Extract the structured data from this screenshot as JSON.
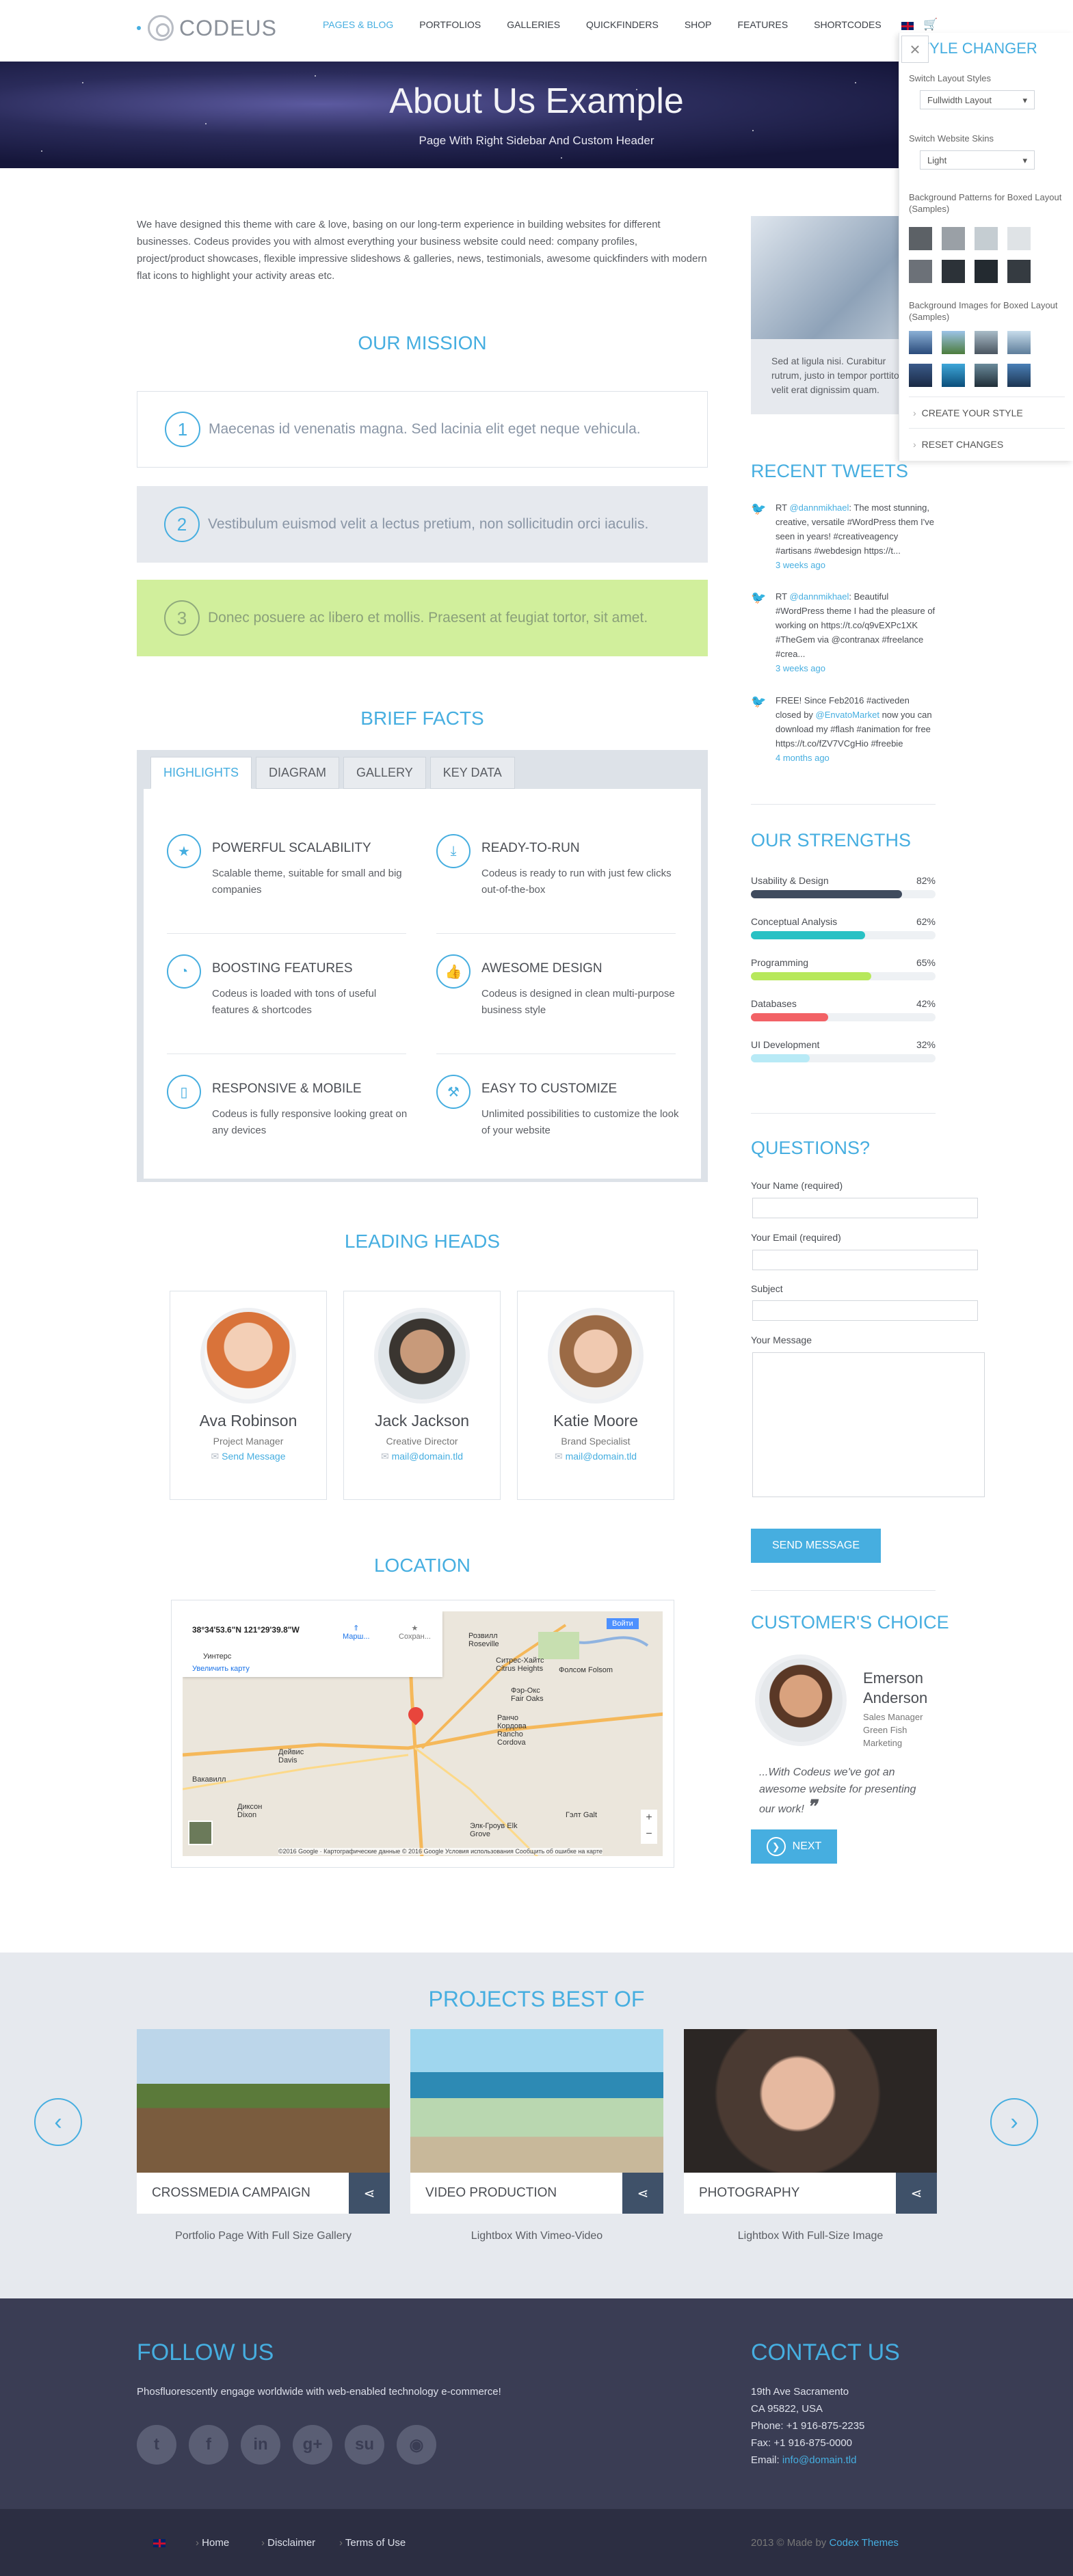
{
  "brand": {
    "name": "CODEUS"
  },
  "nav": {
    "items": [
      "PAGES & BLOG",
      "PORTFOLIOS",
      "GALLERIES",
      "QUICKFINDERS",
      "SHOP",
      "FEATURES",
      "SHORTCODES"
    ]
  },
  "hero": {
    "title": "About Us Example",
    "subtitle": "Page With Right Sidebar And Custom Header"
  },
  "intro": "We have designed this theme with care & love, basing on our long-term experience in building websites for different businesses. Codeus provides you with almost everything your business website could need: company profiles, project/product showcases, flexible impressive slideshows & galleries, news, testimonials, awesome quickfinders with modern flat icons to highlight your activity areas etc.",
  "mission": {
    "title": "OUR MISSION",
    "items": [
      {
        "num": "1",
        "text": "Maecenas id venenatis magna. Sed lacinia elit eget neque vehicula."
      },
      {
        "num": "2",
        "text": "Vestibulum euismod velit a lectus pretium, non sollicitudin orci iaculis."
      },
      {
        "num": "3",
        "text": "Donec posuere ac libero et mollis. Praesent at feugiat tortor, sit amet."
      }
    ]
  },
  "facts": {
    "title": "BRIEF FACTS",
    "tabs": [
      "HIGHLIGHTS",
      "DIAGRAM",
      "GALLERY",
      "KEY DATA"
    ],
    "items": [
      {
        "title": "POWERFUL SCALABILITY",
        "desc": "Scalable theme, suitable for small and big companies",
        "icon": "star-icon"
      },
      {
        "title": "READY-TO-RUN",
        "desc": "Codeus is ready to run with just few clicks out-of-the-box",
        "icon": "download-icon"
      },
      {
        "title": "BOOSTING FEATURES",
        "desc": "Codeus is loaded with tons of useful features & shortcodes",
        "icon": "chart-icon"
      },
      {
        "title": "AWESOME DESIGN",
        "desc": "Codeus is designed in clean multi-purpose business style",
        "icon": "thumbs-up-icon"
      },
      {
        "title": "RESPONSIVE & MOBILE",
        "desc": "Codeus is fully responsive looking great on any devices",
        "icon": "mobile-icon"
      },
      {
        "title": "EASY TO CUSTOMIZE",
        "desc": "Unlimited possibilities to customize the look of your website",
        "icon": "hammer-icon"
      }
    ]
  },
  "heads": {
    "title": "LEADING HEADS",
    "people": [
      {
        "name": "Ava Robinson",
        "role": "Project Manager",
        "mail": "Send Message"
      },
      {
        "name": "Jack Jackson",
        "role": "Creative Director",
        "mail": "mail@domain.tld"
      },
      {
        "name": "Katie Moore",
        "role": "Brand Specialist",
        "mail": "mail@domain.tld"
      }
    ]
  },
  "location": {
    "title": "LOCATION",
    "coords": "38°34'53.6\"N 121°29'39.8\"W",
    "zoom_link": "Увеличить карту",
    "route": "Марш...",
    "save": "Сохран...",
    "login": "Войти",
    "footer": "©2016 Google · Картографические данные © 2016 Google  Условия использования  Сообщить об ошибке на карте",
    "places": [
      "Розвилл Roseville",
      "Ситрес-Хайтс Citrus Heights",
      "Фолсом Folsom",
      "Фэр-Окс Fair Oaks",
      "Ранчо Кордова Rancho Cordova",
      "Дейвис Davis",
      "Элк-Гроув Elk Grove",
      "Уинтерс",
      "Вакавилл",
      "Диксон Dixon",
      "Гэлт Galt"
    ]
  },
  "sidebar": {
    "quote": "Sed at ligula nisi. Curabitur rutrum, justo in tempor porttitor, velit erat dignissim quam.",
    "tweets_title": "RECENT TWEETS",
    "tweets": [
      {
        "pre": "RT ",
        "user": "@dannmikhael",
        "text": ": The most stunning, creative, versatile #WordPress them I've seen in years! #creativeagency #artisans #webdesign https://t...",
        "time": "3 weeks ago"
      },
      {
        "pre": "RT ",
        "user": "@dannmikhael",
        "text": ": Beautiful #WordPress theme I had the pleasure of working on https://t.co/q9vEXPc1XK #TheGem via @contranax #freelance #crea...",
        "time": "3 weeks ago"
      },
      {
        "pre": "FREE! Since Feb2016 #activeden closed by ",
        "user": "@EnvatoMarket",
        "text": " now you can download my #flash #animation for free https://t.co/fZV7VCgHio #freebie",
        "time": "4 months ago"
      }
    ],
    "strengths_title": "OUR STRENGTHS",
    "strengths": [
      {
        "label": "Usability & Design",
        "value": 82,
        "text": "82%",
        "color": "#3f4b5e"
      },
      {
        "label": "Conceptual Analysis",
        "value": 62,
        "text": "62%",
        "color": "#29c1c4"
      },
      {
        "label": "Programming",
        "value": 65,
        "text": "65%",
        "color": "#b7e85c"
      },
      {
        "label": "Databases",
        "value": 42,
        "text": "42%",
        "color": "#f26266"
      },
      {
        "label": "UI Development",
        "value": 32,
        "text": "32%",
        "color": "#b8eaf6"
      }
    ],
    "questions_title": "QUESTIONS?",
    "form": {
      "name": "Your Name (required)",
      "email": "Your Email (required)",
      "subject": "Subject",
      "message": "Your Message",
      "send": "SEND MESSAGE"
    },
    "choice_title": "CUSTOMER'S CHOICE",
    "testimonial": {
      "name": "Emerson Anderson",
      "role": "Sales Manager Green Fish Marketing",
      "quote": "...With Codeus we've got an awesome website for presenting our work!",
      "next": "NEXT"
    }
  },
  "projects": {
    "title": "PROJECTS BEST OF",
    "items": [
      {
        "name": "CROSSMEDIA CAMPAIGN",
        "sub": "Portfolio Page With Full Size Gallery"
      },
      {
        "name": "VIDEO PRODUCTION",
        "sub": "Lightbox With Vimeo-Video"
      },
      {
        "name": "PHOTOGRAPHY",
        "sub": "Lightbox With Full-Size Image"
      }
    ]
  },
  "footer": {
    "follow_title": "FOLLOW US",
    "follow_text": "Phosfluorescently engage worldwide with web-enabled technology e-commerce!",
    "contact_title": "CONTACT US",
    "address1": "19th Ave Sacramento",
    "address2": "CA 95822, USA",
    "phone": "Phone: +1 916-875-2235",
    "fax": "Fax: +1 916-875-0000",
    "email_label": "Email: ",
    "email": "info@domain.tld",
    "links": [
      "Home",
      "Disclaimer",
      "Terms of Use"
    ],
    "copyright": "2013 © Made by ",
    "maker": "Codex Themes"
  },
  "style_changer": {
    "title": "STYLE CHANGER",
    "layout_label": "Switch Layout Styles",
    "layout_value": "Fullwidth Layout",
    "skin_label": "Switch Website Skins",
    "skin_value": "Light",
    "patterns_label": "Background Patterns for Boxed Layout (Samples)",
    "images_label": "Background Images for Boxed Layout (Samples)",
    "create": "CREATE YOUR STYLE",
    "reset": "RESET CHANGES"
  },
  "colors": {
    "accent": "#46aee0",
    "footer": "#3a3d54",
    "mission_green": "#d1ef9c"
  }
}
